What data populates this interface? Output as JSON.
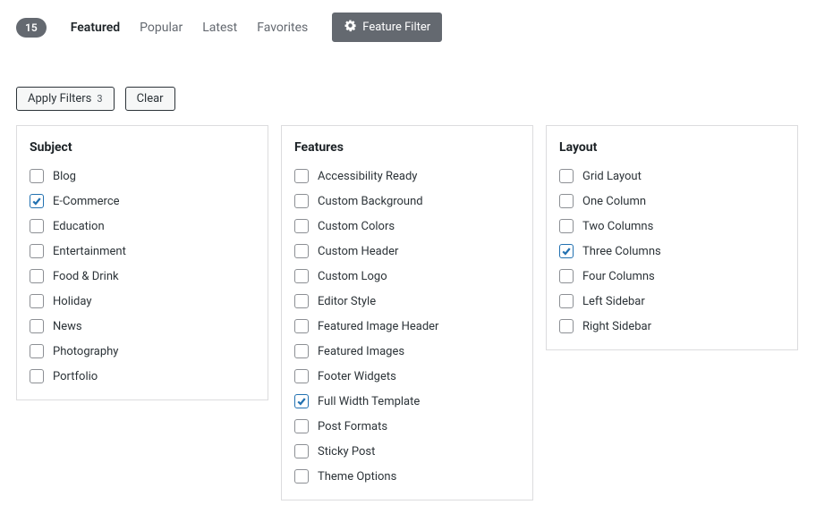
{
  "header": {
    "count": "15",
    "tabs": [
      {
        "label": "Featured",
        "active": true
      },
      {
        "label": "Popular",
        "active": false
      },
      {
        "label": "Latest",
        "active": false
      },
      {
        "label": "Favorites",
        "active": false
      }
    ],
    "feature_filter_label": "Feature Filter"
  },
  "actions": {
    "apply_label": "Apply Filters",
    "apply_count": "3",
    "clear_label": "Clear"
  },
  "filters": [
    {
      "title": "Subject",
      "items": [
        {
          "label": "Blog",
          "checked": false
        },
        {
          "label": "E-Commerce",
          "checked": true
        },
        {
          "label": "Education",
          "checked": false
        },
        {
          "label": "Entertainment",
          "checked": false
        },
        {
          "label": "Food & Drink",
          "checked": false
        },
        {
          "label": "Holiday",
          "checked": false
        },
        {
          "label": "News",
          "checked": false
        },
        {
          "label": "Photography",
          "checked": false
        },
        {
          "label": "Portfolio",
          "checked": false
        }
      ]
    },
    {
      "title": "Features",
      "items": [
        {
          "label": "Accessibility Ready",
          "checked": false
        },
        {
          "label": "Custom Background",
          "checked": false
        },
        {
          "label": "Custom Colors",
          "checked": false
        },
        {
          "label": "Custom Header",
          "checked": false
        },
        {
          "label": "Custom Logo",
          "checked": false
        },
        {
          "label": "Editor Style",
          "checked": false
        },
        {
          "label": "Featured Image Header",
          "checked": false
        },
        {
          "label": "Featured Images",
          "checked": false
        },
        {
          "label": "Footer Widgets",
          "checked": false
        },
        {
          "label": "Full Width Template",
          "checked": true
        },
        {
          "label": "Post Formats",
          "checked": false
        },
        {
          "label": "Sticky Post",
          "checked": false
        },
        {
          "label": "Theme Options",
          "checked": false
        }
      ]
    },
    {
      "title": "Layout",
      "items": [
        {
          "label": "Grid Layout",
          "checked": false
        },
        {
          "label": "One Column",
          "checked": false
        },
        {
          "label": "Two Columns",
          "checked": false
        },
        {
          "label": "Three Columns",
          "checked": true
        },
        {
          "label": "Four Columns",
          "checked": false
        },
        {
          "label": "Left Sidebar",
          "checked": false
        },
        {
          "label": "Right Sidebar",
          "checked": false
        }
      ]
    }
  ]
}
